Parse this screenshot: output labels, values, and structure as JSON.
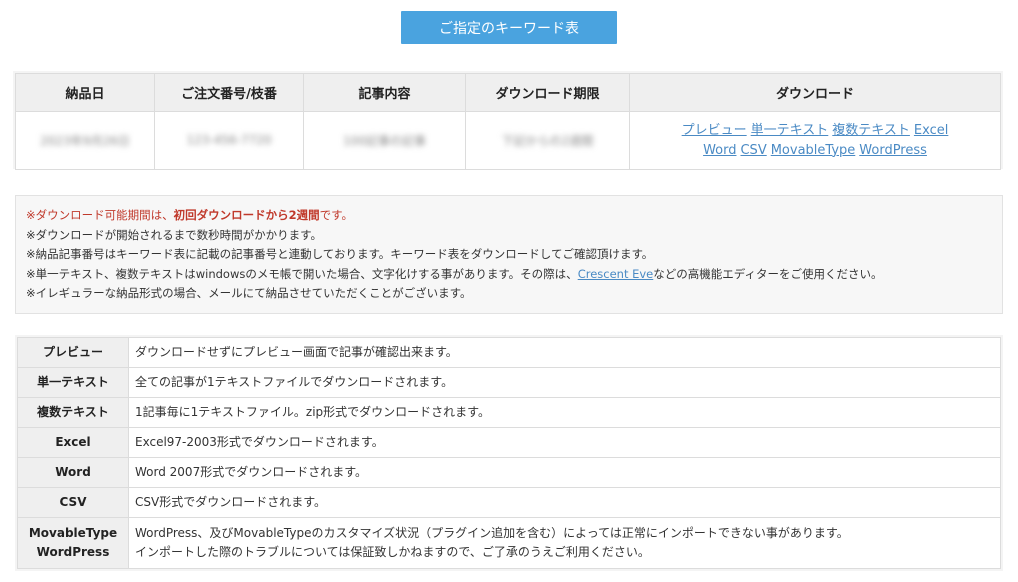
{
  "header": {
    "title": "ご指定のキーワード表"
  },
  "order_table": {
    "headers": [
      "納品日",
      "ご注文番号/枝番",
      "記事内容",
      "ダウンロード期限",
      "ダウンロード"
    ],
    "row": {
      "delivery_date": "2023年9月26日",
      "order_number": "123-456-7720",
      "content": "100記事の記事",
      "deadline": "下記からの2週間"
    },
    "download_links": [
      "プレビュー",
      "単一テキスト",
      "複数テキスト",
      "Excel",
      "Word",
      "CSV",
      "MovableType",
      "WordPress"
    ]
  },
  "notes": {
    "line1_prefix": "※ダウンロード可能期間は、",
    "line1_bold": "初回ダウンロードから2週間",
    "line1_suffix": "です。",
    "line2": "※ダウンロードが開始されるまで数秒時間がかかります。",
    "line3": "※納品記事番号はキーワード表に記載の記事番号と連動しております。キーワード表をダウンロードしてご確認頂けます。",
    "line4_prefix": "※単一テキスト、複数テキストはwindowsのメモ帳で開いた場合、文字化けする事があります。その際は、",
    "line4_link": "Crescent Eve",
    "line4_suffix": "などの高機能エディターをご使用ください。",
    "line5": "※イレギュラーな納品形式の場合、メールにて納品させていただくことがございます。"
  },
  "formats": [
    {
      "name": "プレビュー",
      "desc": "ダウンロードせずにプレビュー画面で記事が確認出来ます。"
    },
    {
      "name": "単一テキスト",
      "desc": "全ての記事が1テキストファイルでダウンロードされます。"
    },
    {
      "name": "複数テキスト",
      "desc": "1記事毎に1テキストファイル。zip形式でダウンロードされます。"
    },
    {
      "name": "Excel",
      "desc": "Excel97-2003形式でダウンロードされます。"
    },
    {
      "name": "Word",
      "desc": "Word 2007形式でダウンロードされます。"
    },
    {
      "name": "CSV",
      "desc": "CSV形式でダウンロードされます。"
    },
    {
      "name1": "MovableType",
      "name2": "WordPress",
      "desc1": "WordPress、及びMovableTypeのカスタマイズ状況（プラグイン追加を含む）によっては正常にインポートできない事があります。",
      "desc2": "インポートした際のトラブルについては保証致しかねますので、ご了承のうえご利用ください。"
    }
  ],
  "colors": {
    "accent": "#4aa3df",
    "link": "#4a8ac4",
    "warning": "#c0392b"
  }
}
